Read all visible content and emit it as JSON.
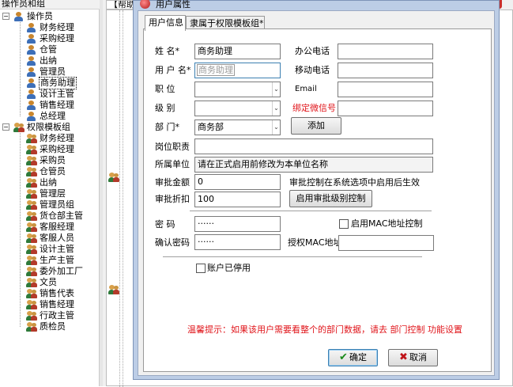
{
  "tree": {
    "header": "操作员和组",
    "operators_label": "操作员",
    "operators": [
      "财务经理",
      "采购经理",
      "仓管",
      "出纳",
      "管理员",
      "商务助理",
      "设计主管",
      "销售经理",
      "总经理"
    ],
    "selected_operator": "商务助理",
    "templates_label": "权限模板组",
    "templates": [
      "财务经理",
      "采购经理",
      "采购员",
      "仓管员",
      "出纳",
      "管理层",
      "管理员组",
      "货仓部主管",
      "客服经理",
      "客服人员",
      "设计主管",
      "生产主管",
      "委外加工厂",
      "文员",
      "销售代表",
      "销售经理",
      "行政主管",
      "质检员"
    ]
  },
  "background": {
    "tab_label": "【帮助"
  },
  "dialog": {
    "title": "用户属性",
    "tabs": [
      "用户信息",
      "隶属于权限模板组*"
    ],
    "active_tab": "用户信息",
    "form": {
      "name_label": "姓    名*",
      "name_value": "商务助理",
      "username_label": "用 户 名*",
      "username_value": "商务助理",
      "position_label": "职    位",
      "position_value": "",
      "level_label": "级    别",
      "level_value": "",
      "dept_label": "部    门*",
      "dept_value": "商务部",
      "add_button": "添加",
      "office_phone_label": "办公电话",
      "office_phone_value": "",
      "mobile_label": "移动电话",
      "mobile_value": "",
      "email_label": "Email",
      "email_value": "",
      "wechat_label": "绑定微信号",
      "wechat_value": "",
      "duty_label": "岗位职责",
      "duty_value": "",
      "unit_label": "所属单位",
      "unit_value": "请在正式启用前修改为本单位名称",
      "approval_amount_label": "审批金额",
      "approval_amount_value": "0",
      "approval_note": "审批控制在系统选项中启用后生效",
      "discount_label": "审批折扣",
      "discount_value": "100",
      "approval_level_button": "启用审批级别控制",
      "password_label": "密    码",
      "password_value": "······",
      "confirm_label": "确认密码",
      "confirm_value": "······",
      "mac_checkbox_label": "启用MAC地址控制",
      "mac_label": "授权MAC地址",
      "mac_value": "",
      "disabled_label": "账户已停用",
      "tip": "温馨提示：如果该用户需要看整个的部门数据，请去 部门控制 功能设置"
    },
    "ok_button": "确定",
    "cancel_button": "取消"
  },
  "colors": {
    "dialog_frame": "#bccde6",
    "tip_red": "#e0141a",
    "selection_outline": "#000000"
  }
}
